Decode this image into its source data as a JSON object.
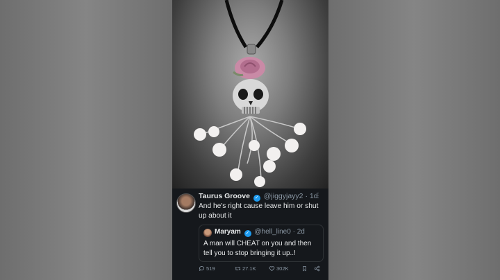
{
  "tweet": {
    "author_name": "Taurus Groove",
    "author_handle": "@jiggyjayy2",
    "age": "1d",
    "separator": "·",
    "more": "⋮",
    "verified_mark": "✓",
    "text": "And he's right cause leave him or shut up about it"
  },
  "quote": {
    "author_name": "Maryam",
    "author_handle": "@hell_line0",
    "age": "2d",
    "separator": "·",
    "verified_mark": "✓",
    "text": "A man will CHEAT on you and then tell you to stop bringing it up..!"
  },
  "actions": {
    "replies": "519",
    "retweets": "27.1K",
    "likes": "302K"
  },
  "colors": {
    "background": "#15181c",
    "verified": "#1d9bf0",
    "muted": "#8b98a5"
  },
  "icons": [
    "reply-icon",
    "retweet-icon",
    "like-icon",
    "bookmark-icon",
    "share-icon",
    "verified-icon",
    "more-icon"
  ]
}
